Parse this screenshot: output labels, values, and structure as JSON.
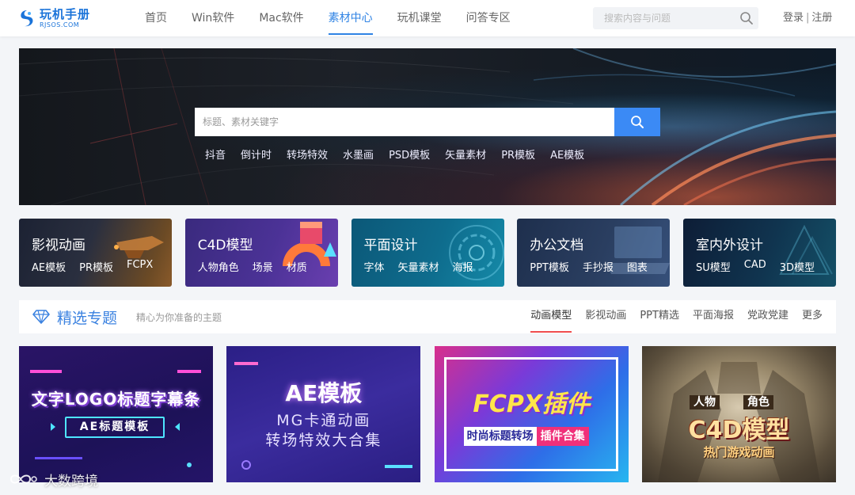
{
  "header": {
    "logo_cn": "玩机手册",
    "logo_en": "RJSOS.COM",
    "nav": [
      "首页",
      "Win软件",
      "Mac软件",
      "素材中心",
      "玩机课堂",
      "问答专区"
    ],
    "nav_active": "素材中心",
    "search_placeholder": "搜索内容与问题",
    "login": "登录",
    "register": "注册"
  },
  "banner": {
    "search_placeholder": "标题、素材关键字",
    "hot_tags": [
      "抖音",
      "倒计时",
      "转场特效",
      "水墨画",
      "PSD模板",
      "矢量素材",
      "PR模板",
      "AE模板"
    ]
  },
  "categories": [
    {
      "title": "影视动画",
      "subs": [
        "AE模板",
        "PR模板",
        "FCPX"
      ]
    },
    {
      "title": "C4D模型",
      "subs": [
        "人物角色",
        "场景",
        "材质"
      ]
    },
    {
      "title": "平面设计",
      "subs": [
        "字体",
        "矢量素材",
        "海报"
      ]
    },
    {
      "title": "办公文档",
      "subs": [
        "PPT模板",
        "手抄报",
        "图表"
      ]
    },
    {
      "title": "室内外设计",
      "subs": [
        "SU模型",
        "CAD",
        "3D模型"
      ]
    }
  ],
  "section": {
    "title": "精选专题",
    "desc": "精心为你准备的主题",
    "tabs": [
      "动画模型",
      "影视动画",
      "PPT精选",
      "平面海报",
      "党政党建",
      "更多"
    ],
    "active_tab": "动画模型"
  },
  "topics": {
    "t1": {
      "head": "文字LOGO标题字幕条",
      "pill": "AE标题模板"
    },
    "t2": {
      "head": "AE模板",
      "line2": "MG卡通动画",
      "line3": "转场特效大合集"
    },
    "t3": {
      "head": "FCPX插件",
      "strip_a": "时尚标题转场",
      "strip_b": "插件合集"
    },
    "t4": {
      "tag1": "人物",
      "tag2": "角色",
      "head": "C4D模型",
      "sub": "热门游戏动画"
    }
  },
  "watermark": "大数跨境",
  "colors": {
    "accent": "#2f83e4",
    "tab_underline": "#f04e4e",
    "search_button": "#3b8af5"
  }
}
